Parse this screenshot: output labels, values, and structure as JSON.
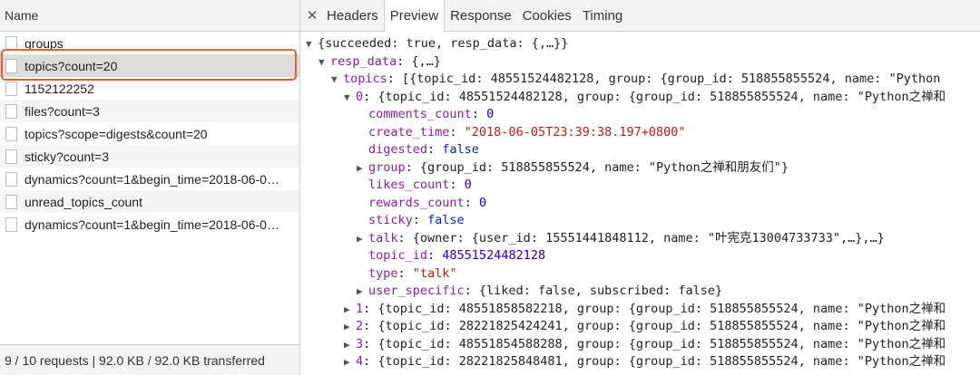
{
  "left_panel": {
    "header": "Name",
    "requests": [
      "groups",
      "topics?count=20",
      "1152122252",
      "files?count=3",
      "topics?scope=digests&count=20",
      "sticky?count=3",
      "dynamics?count=1&begin_time=2018-06-0…",
      "unread_topics_count",
      "dynamics?count=1&begin_time=2018-06-0…"
    ],
    "footer": "9 / 10 requests | 92.0 KB / 92.0 KB transferred"
  },
  "tabs": [
    "Headers",
    "Preview",
    "Response",
    "Cookies",
    "Timing"
  ],
  "preview": {
    "l1": "{succeeded: true, resp_data: {,…}}",
    "l2_key": "resp_data",
    "l2_val": ": {,…}",
    "l3_key": "topics",
    "l3_val": ": [{topic_id: 48551524482128, group: {group_id: 518855855524, name: \"Python",
    "l4_key": "0",
    "l4_val": ": {topic_id: 48551524482128, group: {group_id: 518855855524, name: \"Python之禅和",
    "comments_count_key": "comments_count",
    "comments_count_val": "0",
    "create_time_key": "create_time",
    "create_time_val": "\"2018-06-05T23:39:38.197+0800\"",
    "digested_key": "digested",
    "digested_val": "false",
    "group_key": "group",
    "group_val": ": {group_id: 518855855524, name: \"Python之禅和朋友们\"}",
    "likes_count_key": "likes_count",
    "likes_count_val": "0",
    "rewards_count_key": "rewards_count",
    "rewards_count_val": "0",
    "sticky_key": "sticky",
    "sticky_val": "false",
    "talk_key": "talk",
    "talk_val": ": {owner: {user_id: 15551441848112, name: \"叶宪克13004733733\",…},…}",
    "topic_id_key": "topic_id",
    "topic_id_val": "48551524482128",
    "type_key": "type",
    "type_val": "\"talk\"",
    "user_specific_key": "user_specific",
    "user_specific_val": ": {liked: false, subscribed: false}",
    "items": [
      {
        "key": "1",
        "val": ": {topic_id: 48551858582218, group: {group_id: 518855855524, name: \"Python之禅和"
      },
      {
        "key": "2",
        "val": ": {topic_id: 28221825424241, group: {group_id: 518855855524, name: \"Python之禅和"
      },
      {
        "key": "3",
        "val": ": {topic_id: 48551854588288, group: {group_id: 518855855524, name: \"Python之禅和"
      },
      {
        "key": "4",
        "val": ": {topic_id: 28221825848481, group: {group_id: 518855855524, name: \"Python之禅和"
      }
    ]
  },
  "colors": {
    "highlight": "#ee5a2a",
    "key": "#8a1ea3",
    "string": "#c41a16",
    "number": "#1c00cf"
  }
}
